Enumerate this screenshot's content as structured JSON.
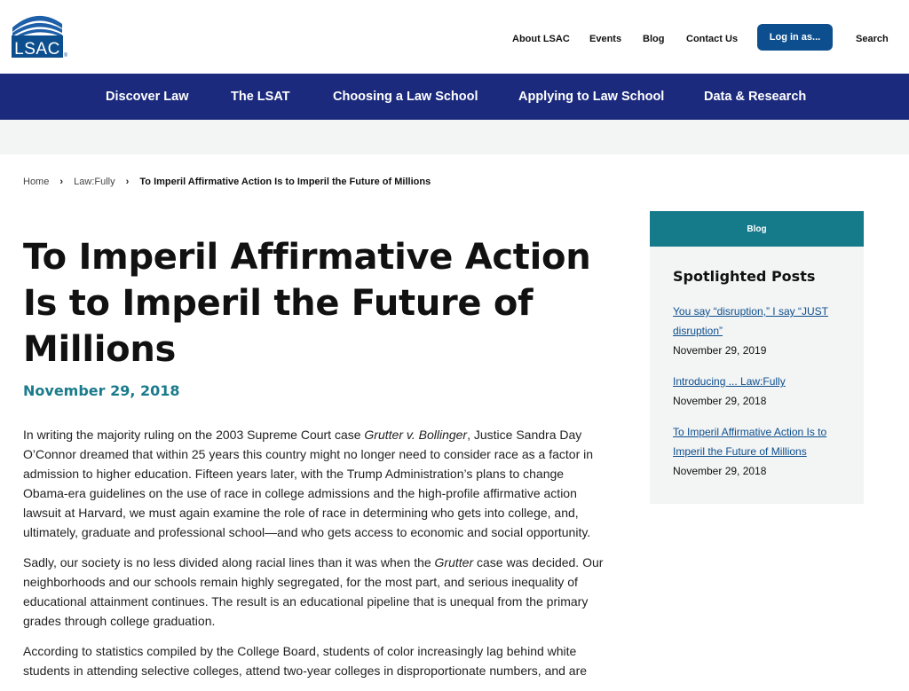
{
  "brand": {
    "logo_text": "LSAC",
    "registered": "®",
    "primary_color": "#0d4f8e",
    "nav_color": "#1b2a7c",
    "accent_color": "#157a8a"
  },
  "topnav": {
    "items": [
      "About LSAC",
      "Events",
      "Blog",
      "Contact Us"
    ],
    "login_label": "Log in as...",
    "search_label": "Search"
  },
  "mainnav": {
    "items": [
      "Discover Law",
      "The LSAT",
      "Choosing a Law School",
      "Applying to Law School",
      "Data & Research"
    ]
  },
  "breadcrumb": {
    "items": [
      "Home",
      "Law:Fully"
    ],
    "current": "To Imperil Affirmative Action Is to Imperil the Future of Millions",
    "separator": "›"
  },
  "article": {
    "title": "To Imperil Affirmative Action Is to Imperil the Future of Millions",
    "date": "November 29, 2018",
    "p1_a": "In writing the majority ruling on the 2003 Supreme Court case ",
    "p1_case": "Grutter v. Bollinger",
    "p1_b": ", Justice Sandra Day O’Connor dreamed that within 25 years this country might no longer need to consider race as a factor in admission to higher education. Fifteen years later, with the Trump Administration’s plans to change Obama-era guidelines on the use of race in college admissions and the high-profile affirmative action lawsuit at Harvard, we must again examine the role of race in determining who gets into college, and, ultimately, graduate and professional school—and who gets access to economic and social opportunity.",
    "p2_a": "Sadly, our society is no less divided along racial lines than it was when the ",
    "p2_case": "Grutter",
    "p2_b": " case was decided. Our neighborhoods and our schools remain highly segregated, for the most part, and serious inequality of educational attainment continues. The result is an educational pipeline that is unequal from the primary grades through college graduation.",
    "p3": "According to statistics compiled by the College Board, students of color increasingly lag behind white students in attending selective colleges, attend two-year colleges in disproportionate numbers, and are"
  },
  "sidebar": {
    "tab_label": "Blog",
    "heading": "Spotlighted Posts",
    "posts": [
      {
        "title": "You say “disruption,” I say “JUST disruption”",
        "date": "November 29, 2019"
      },
      {
        "title": "Introducing ... Law:Fully",
        "date": "November 29, 2018"
      },
      {
        "title": "To Imperil Affirmative Action Is to Imperil the Future of Millions",
        "date": "November 29, 2018"
      }
    ]
  }
}
